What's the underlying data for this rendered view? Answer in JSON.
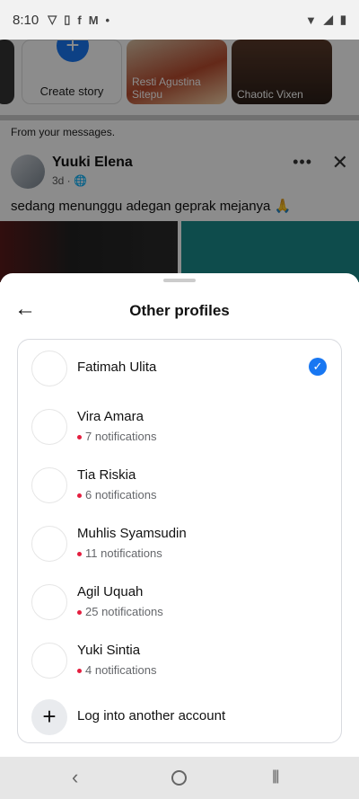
{
  "status_bar": {
    "time": "8:10",
    "notification_icons": [
      "vpn-shield-icon",
      "phone-lock-icon",
      "facebook-icon",
      "gmail-icon",
      "dot-icon"
    ],
    "right_icons": [
      "wifi-icon",
      "cell-signal-icon",
      "battery-icon"
    ]
  },
  "feed": {
    "stories": [
      {
        "label": ""
      },
      {
        "label": "Create story"
      },
      {
        "label": "Resti Agustina Sitepu"
      },
      {
        "label": "Chaotic Vixen"
      }
    ],
    "from_messages": "From your messages.",
    "post": {
      "author": "Yuuki Elena",
      "meta": "3d · 🌐",
      "text": "sedang menunggu adegan geprak mejanya 🙏"
    }
  },
  "sheet": {
    "title": "Other profiles",
    "profiles": [
      {
        "name": "Fatimah Ulita",
        "notifications": "",
        "selected": true
      },
      {
        "name": "Vira Amara",
        "notifications": "7 notifications",
        "selected": false
      },
      {
        "name": "Tia Riskia",
        "notifications": "6 notifications",
        "selected": false
      },
      {
        "name": "Muhlis Syamsudin",
        "notifications": "11 notifications",
        "selected": false
      },
      {
        "name": "Agil Uquah",
        "notifications": "25 notifications",
        "selected": false
      },
      {
        "name": "Yuki Sintia",
        "notifications": "4 notifications",
        "selected": false
      }
    ],
    "add_account_label": "Log into another account"
  },
  "colors": {
    "accent": "#1877f2",
    "notification_dot": "#e41e3f"
  }
}
